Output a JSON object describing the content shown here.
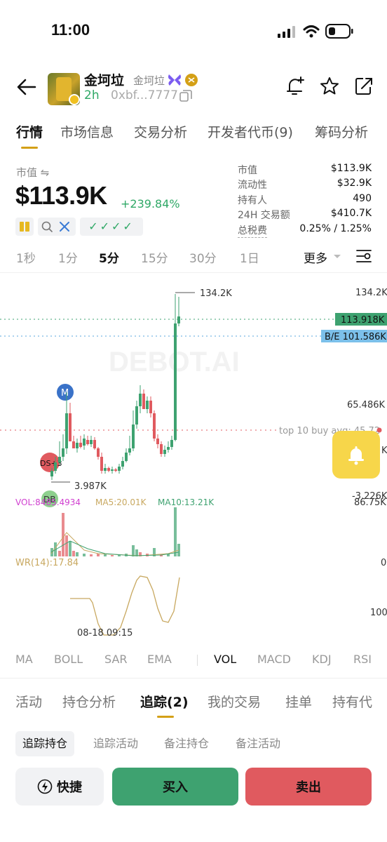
{
  "status_bar": {
    "time": "11:00"
  },
  "token": {
    "name": "金坷垃",
    "sub_name": "金坷垃",
    "age": "2h",
    "address": "0xbf...7777"
  },
  "tabs": [
    "行情",
    "市场信息",
    "交易分析",
    "开发者代币(9)",
    "筹码分析"
  ],
  "market": {
    "label": "市值 ⇋",
    "value": "$113.9K",
    "change": "+239.84%"
  },
  "stats": [
    {
      "k": "市值",
      "v": "$113.9K"
    },
    {
      "k": "流动性",
      "v": "$32.9K"
    },
    {
      "k": "持有人",
      "v": "490"
    },
    {
      "k": "24H 交易额",
      "v": "$410.7K"
    },
    {
      "k": "总税费",
      "v": "0.25% / 1.25%"
    }
  ],
  "badges": {
    "checks": "✓✓✓✓"
  },
  "intervals": [
    "1秒",
    "1分",
    "5分",
    "15分",
    "30分",
    "1日"
  ],
  "more_label": "更多",
  "chart": {
    "watermark": "DEBOT.AI",
    "price_labels": [
      "134.2K",
      "65.486K",
      "-3.226K"
    ],
    "current_price": "113.918K",
    "be_price": "B/E 101.586K",
    "peak_label": "134.2K",
    "low_label": "3.987K",
    "top10_label": "top 10 buy avg: 45.72",
    "m_marker": "M",
    "ds_marker": "DS+3",
    "db_marker": "DB",
    "vol_label": "VOL:8485.4934",
    "ma5_label": "MA5:20.01K",
    "ma10_label": "MA10:13.21K",
    "vol_max": "86.75K",
    "wr_label": "WR(14):17.84",
    "wr_0": "0",
    "wr_100": "100",
    "date_label": "08-18 09:15",
    "right_cut_label": "K"
  },
  "indicator_tabs": [
    "MA",
    "BOLL",
    "SAR",
    "EMA",
    "VOL",
    "MACD",
    "KDJ",
    "RSI"
  ],
  "section_tabs": [
    "活动",
    "持仓分析",
    "追踪(2)",
    "我的交易",
    "挂单",
    "持有代"
  ],
  "sub_tabs": [
    "追踪持仓",
    "追踪活动",
    "备注持仓",
    "备注活动"
  ],
  "buttons": {
    "quick": "快捷",
    "buy": "买入",
    "sell": "卖出"
  },
  "colors": {
    "green": "#2fa866",
    "red": "#e05a5f",
    "gold": "#d4a017"
  }
}
